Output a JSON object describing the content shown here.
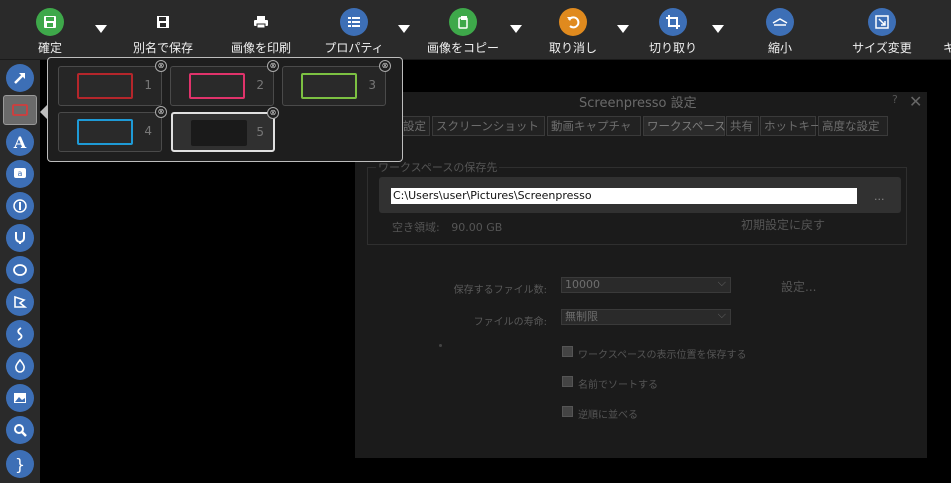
{
  "toolbar": {
    "confirm": "確定",
    "save_as": "別名で保存",
    "print": "画像を印刷",
    "properties": "プロパティ",
    "copy_image": "画像をコピー",
    "undo": "取り消し",
    "crop": "切り取り",
    "shrink": "縮小",
    "resize": "サイズ変更",
    "overflow": "キ"
  },
  "dialog": {
    "title": "Screenpresso 設定",
    "help": "?",
    "close": "✕",
    "tabs": [
      "設定",
      "スクリーンショット",
      "動画キャプチャ",
      "ワークスペース",
      "共有",
      "ホットキー",
      "高度な設定"
    ],
    "selected_tab": "ワークスペース",
    "group_title": "ワークスペースの保存先",
    "path": "C:\\Users\\user\\Pictures\\Screenpresso",
    "browse": "...",
    "free_space_label": "空き領域:",
    "free_space": "90.00 GB",
    "restore_default": "初期設定に戻す",
    "max_files_label": "保存するファイル数:",
    "max_files": "10000",
    "settings_link": "設定...",
    "lifetime_label": "ファイルの寿命:",
    "lifetime": "無制限",
    "chk_save_position": "ワークスペースの表示位置を保存する",
    "chk_sort_name": "名前でソートする",
    "chk_reverse": "逆順に並べる"
  },
  "palette": {
    "styles": [
      {
        "num": "1",
        "color": "#b5262b"
      },
      {
        "num": "2",
        "color": "#e0336b"
      },
      {
        "num": "3",
        "color": "#7cc142"
      },
      {
        "num": "4",
        "color": "#1e9ad6"
      },
      {
        "num": "5",
        "color": "#1a1a1a"
      }
    ],
    "selected": "5",
    "delete_icon": "⊗"
  },
  "colors": {
    "confirm": "#3ea84a",
    "blue": "#3d6fb6",
    "copy": "#3ea84a",
    "undo": "#e08a1e"
  }
}
